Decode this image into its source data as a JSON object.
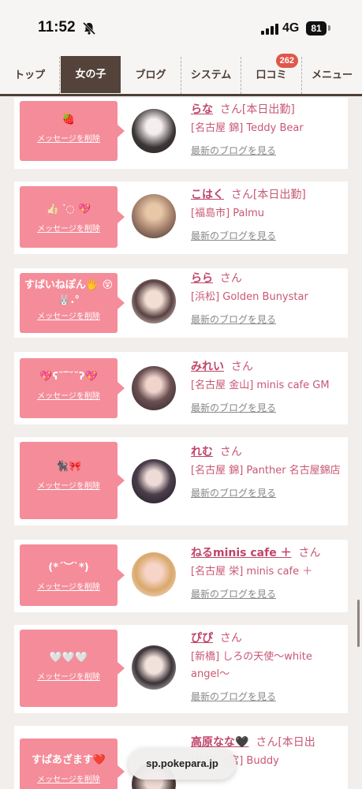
{
  "status_bar": {
    "time": "11:52",
    "network": "4G",
    "battery": "81"
  },
  "nav": {
    "tabs": [
      {
        "label": "トップ"
      },
      {
        "label": "女の子"
      },
      {
        "label": "ブログ"
      },
      {
        "label": "システム"
      },
      {
        "label": "口コミ",
        "badge": "262"
      },
      {
        "label": "メニュー"
      }
    ]
  },
  "delete_label": "メッセージを削除",
  "blog_link": "最新のブログを見る",
  "honorific": "さん",
  "cards": [
    {
      "message": "🍓",
      "name": "らな",
      "status": "[本日出勤]",
      "shop": "[名古屋 錦] Teddy Bear"
    },
    {
      "message": "👍🏻 ᐝ◌ 💖",
      "name": "こはく",
      "status": "[本日出勤]",
      "shop": "[福島市] Palmu"
    },
    {
      "message": "すばいねぽん🖐 😵🐰.°",
      "name": "らら",
      "status": "",
      "shop": "[浜松] Golden Bunystar"
    },
    {
      "message": "💖ʕ˘‾˘˘ʔ💖",
      "name": "みれい",
      "status": "",
      "shop": "[名古屋 金山] minis cafe GM"
    },
    {
      "message": "🐈‍⬛🎀",
      "name": "れむ",
      "status": "",
      "shop": "[名古屋 錦] Panther 名古屋錦店"
    },
    {
      "message": "(*´︶`*)",
      "name": "ねるminis cafe ＋",
      "status": "",
      "shop": "[名古屋 栄] minis cafe ＋"
    },
    {
      "message": "🤍🤍🤍",
      "name": "ぴぴ",
      "status": "",
      "shop": "[新橋] しろの天使〜white angel〜"
    },
    {
      "message": "すぱあざます❤️",
      "name": "高原なな🖤",
      "status": "[本日出",
      "shop": "[尾張 一宮] Buddy"
    }
  ],
  "url_bar": "sp.pokepara.jp"
}
